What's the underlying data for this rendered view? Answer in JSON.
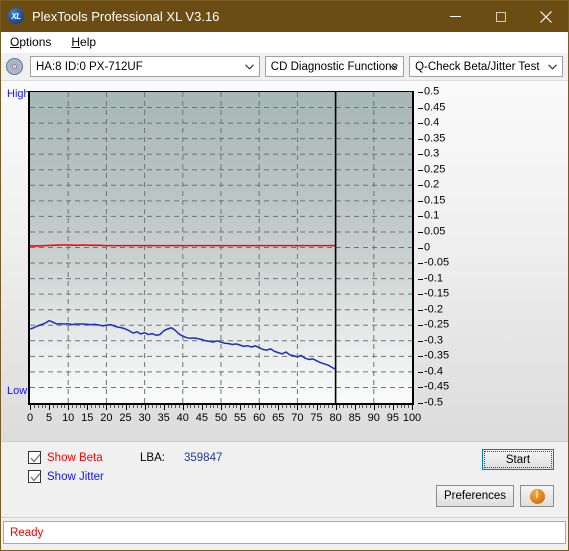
{
  "window": {
    "title": "PlexTools Professional XL V3.16",
    "icon": "xl-disc-icon",
    "minimize_label": "minimize-icon",
    "maximize_label": "maximize-icon",
    "close_label": "close-icon",
    "titlebar_color": "#6b4c12"
  },
  "menubar": {
    "items": [
      {
        "label": "Options",
        "accel": "O"
      },
      {
        "label": "Help",
        "accel": "H"
      }
    ]
  },
  "toolbar": {
    "drive_select": "HA:8 ID:0  PX-712UF",
    "function_select": "CD Diagnostic Functions",
    "test_select": "Q-Check Beta/Jitter Test"
  },
  "graph": {
    "high_label": "High",
    "low_label": "Low"
  },
  "controls": {
    "show_beta": "Show Beta",
    "show_jitter": "Show Jitter",
    "show_beta_checked": true,
    "show_jitter_checked": true,
    "lba_label": "LBA:",
    "lba_value": "359847",
    "start_label": "Start",
    "preferences_label": "Preferences",
    "info_label": "i",
    "beta_color": "#ff0000",
    "jitter_color": "#1414ff"
  },
  "statusbar": {
    "text": "Ready",
    "color": "#ff0000"
  },
  "chart_data": {
    "type": "line",
    "title": "Q-Check Beta/Jitter Test",
    "xlabel": "",
    "ylabel": "",
    "xlim": [
      0,
      100
    ],
    "ylim": [
      -0.5,
      0.5
    ],
    "grid": true,
    "legend": "none",
    "x_ticks": [
      0,
      5,
      10,
      15,
      20,
      25,
      30,
      35,
      40,
      45,
      50,
      55,
      60,
      65,
      70,
      75,
      80,
      85,
      90,
      95,
      100
    ],
    "y_ticks": [
      0.5,
      0.45,
      0.4,
      0.35,
      0.3,
      0.25,
      0.2,
      0.15,
      0.1,
      0.05,
      0,
      -0.05,
      -0.1,
      -0.15,
      -0.2,
      -0.25,
      -0.3,
      -0.35,
      -0.4,
      -0.45,
      -0.5
    ],
    "marker_line_x": 80,
    "data_end_x": 80,
    "series": [
      {
        "name": "Beta",
        "color": "#ff0000",
        "x": [
          0,
          2,
          4,
          6,
          8,
          10,
          12,
          14,
          16,
          18,
          20,
          24,
          28,
          32,
          36,
          40,
          44,
          48,
          52,
          56,
          60,
          64,
          68,
          72,
          76,
          80
        ],
        "values": [
          0.005,
          0.005,
          0.006,
          0.007,
          0.008,
          0.008,
          0.007,
          0.008,
          0.007,
          0.007,
          0.006,
          0.006,
          0.006,
          0.006,
          0.006,
          0.006,
          0.006,
          0.006,
          0.006,
          0.006,
          0.006,
          0.006,
          0.006,
          0.006,
          0.006,
          0.006
        ]
      },
      {
        "name": "Jitter",
        "color": "#1a2fbf",
        "x": [
          0,
          1,
          2,
          3,
          4,
          5,
          6,
          7,
          8,
          9,
          10,
          11,
          12,
          13,
          14,
          15,
          16,
          17,
          18,
          19,
          20,
          21,
          22,
          23,
          24,
          25,
          26,
          27,
          28,
          29,
          30,
          31,
          32,
          33,
          34,
          35,
          36,
          37,
          38,
          39,
          40,
          41,
          42,
          43,
          44,
          45,
          46,
          47,
          48,
          49,
          50,
          51,
          52,
          53,
          54,
          55,
          56,
          57,
          58,
          59,
          60,
          61,
          62,
          63,
          64,
          65,
          66,
          67,
          68,
          69,
          70,
          71,
          72,
          73,
          74,
          75,
          76,
          77,
          78,
          79,
          80
        ],
        "values": [
          -0.262,
          -0.258,
          -0.252,
          -0.248,
          -0.243,
          -0.235,
          -0.24,
          -0.246,
          -0.245,
          -0.246,
          -0.245,
          -0.248,
          -0.246,
          -0.246,
          -0.246,
          -0.247,
          -0.248,
          -0.247,
          -0.249,
          -0.252,
          -0.25,
          -0.248,
          -0.252,
          -0.256,
          -0.258,
          -0.262,
          -0.268,
          -0.275,
          -0.271,
          -0.278,
          -0.274,
          -0.28,
          -0.277,
          -0.282,
          -0.28,
          -0.268,
          -0.262,
          -0.258,
          -0.266,
          -0.278,
          -0.285,
          -0.29,
          -0.292,
          -0.291,
          -0.293,
          -0.296,
          -0.3,
          -0.302,
          -0.304,
          -0.3,
          -0.304,
          -0.308,
          -0.309,
          -0.312,
          -0.31,
          -0.314,
          -0.318,
          -0.316,
          -0.32,
          -0.316,
          -0.322,
          -0.328,
          -0.33,
          -0.326,
          -0.334,
          -0.338,
          -0.342,
          -0.336,
          -0.345,
          -0.348,
          -0.352,
          -0.347,
          -0.356,
          -0.36,
          -0.358,
          -0.364,
          -0.37,
          -0.374,
          -0.378,
          -0.385,
          -0.392
        ]
      }
    ]
  }
}
